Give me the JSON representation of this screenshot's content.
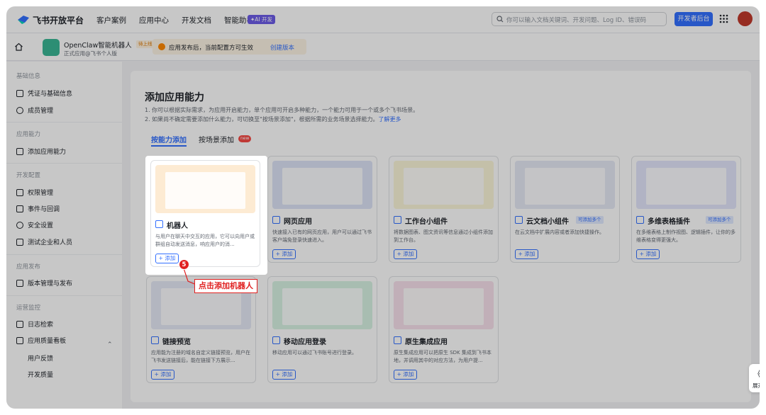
{
  "topnav": {
    "brand": "飞书开放平台",
    "links": [
      "客户案例",
      "应用中心",
      "开发文档",
      "智能助手"
    ],
    "ai_badge": "✦AI 开发",
    "search_placeholder": "你可以输入文档关键词、开发问题、Log ID、错误码",
    "dev_button": "开发者后台"
  },
  "subhead": {
    "app_name": "OpenClaw智能机器人",
    "app_status": "待上线",
    "app_sub": "正式应用@飞书个人版",
    "notice_text": "应用发布后，当前配置方可生效",
    "notice_link": "创建版本"
  },
  "sidebar": {
    "groups": [
      "基础信息",
      "应用能力",
      "开发配置",
      "应用发布",
      "运营监控"
    ],
    "items": [
      "凭证与基础信息",
      "成员管理",
      "添加应用能力",
      "权限管理",
      "事件与回调",
      "安全设置",
      "测试企业和人员",
      "版本管理与发布",
      "日志检索",
      "应用质量看板"
    ],
    "subitems": [
      "用户反馈",
      "开发质量"
    ]
  },
  "main": {
    "title": "添加应用能力",
    "desc1": "1. 你可以根据实际需求，为应用开启能力，单个应用可开启多种能力，一个能力可用于一个或多个飞书场景。",
    "desc2": "2. 如果尚不确定需要添加什么能力，可切换至\"按场景添加\"，根据所需的业务场景选择能力。",
    "desc2_link": "了解更多",
    "tabs": [
      "按能力添加",
      "按场景添加"
    ],
    "new_badge": "new"
  },
  "cards": [
    {
      "title": "机器人",
      "tag": "",
      "desc": "与用户在聊天中交互的应用，它可以向用户或群组自动发送消息，响应用户的消...",
      "add": "+ 添加",
      "color": "#fdebd3"
    },
    {
      "title": "网页应用",
      "tag": "",
      "desc": "快速接入已有的网页应用，用户可以通过飞书客户端免登录快速进入。",
      "add": "+ 添加",
      "color": "#dde3f7"
    },
    {
      "title": "工作台小组件",
      "tag": "",
      "desc": "将数据图表、图文资讯等信息通过小组件添加到工作台。",
      "add": "+ 添加",
      "color": "#fbf7d9"
    },
    {
      "title": "云文档小组件",
      "tag": "可添加多个",
      "desc": "在云文档中扩展内容或者添加快捷操作。",
      "add": "+ 添加",
      "color": "#e6e9f5"
    },
    {
      "title": "多维表格插件",
      "tag": "可添加多个",
      "desc": "在多维表格上制作视图、逻辑插件，让你的多维表格变得更强大。",
      "add": "+ 添加",
      "color": "#e3e6fb"
    },
    {
      "title": "链接预览",
      "tag": "",
      "desc": "应用能为注册的域名自定义链接预览，用户在飞书发送链接后，能在链接下方展示...",
      "add": "+ 添加",
      "color": "#e6e9f7"
    },
    {
      "title": "移动应用登录",
      "tag": "",
      "desc": "移动应用可以通过飞书账号进行登录。",
      "add": "+ 添加",
      "color": "#d8f3e3"
    },
    {
      "title": "原生集成应用",
      "tag": "",
      "desc": "原生集成应用可以把原生 SDK 集成到飞书本地，并调用其中的对应方法，为用户提...",
      "add": "+ 添加",
      "color": "#f8e1ec"
    }
  ],
  "annotation": {
    "step": "5",
    "callout": "点击添加机器人"
  },
  "expand": {
    "arrow": "《",
    "label": "展开"
  }
}
